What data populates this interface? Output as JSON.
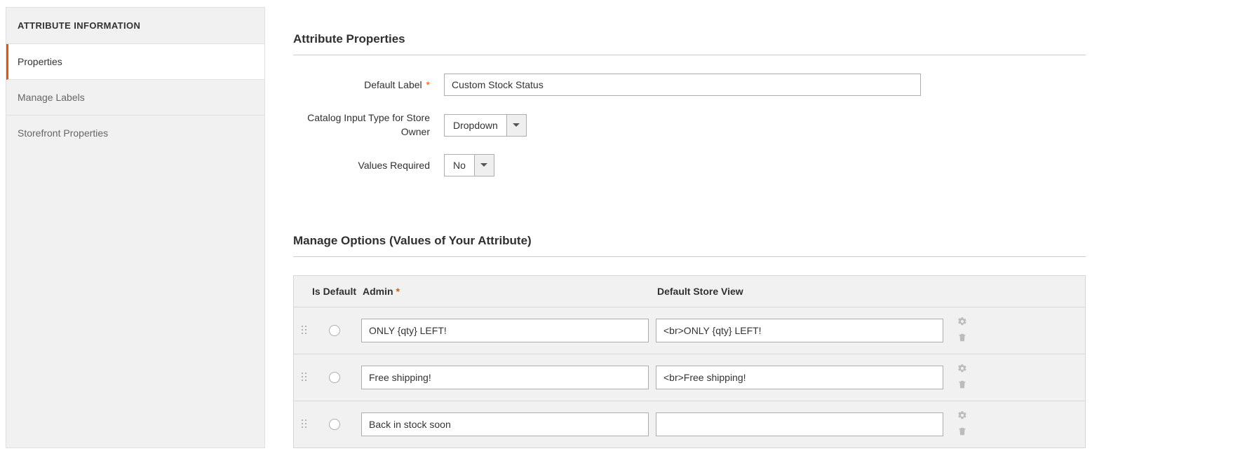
{
  "sidebar": {
    "header": "ATTRIBUTE INFORMATION",
    "items": [
      {
        "label": "Properties",
        "active": true
      },
      {
        "label": "Manage Labels",
        "active": false
      },
      {
        "label": "Storefront Properties",
        "active": false
      }
    ]
  },
  "attribute_properties": {
    "title": "Attribute Properties",
    "default_label_label": "Default Label",
    "default_label_value": "Custom Stock Status",
    "catalog_input_type_label": "Catalog Input Type for Store Owner",
    "catalog_input_type_value": "Dropdown",
    "values_required_label": "Values Required",
    "values_required_value": "No"
  },
  "manage_options": {
    "title": "Manage Options (Values of Your Attribute)",
    "columns": {
      "is_default": "Is Default",
      "admin": "Admin",
      "default_store_view": "Default Store View"
    },
    "rows": [
      {
        "admin": "ONLY {qty} LEFT!",
        "default_store_view": "<br>ONLY {qty} LEFT!"
      },
      {
        "admin": "Free shipping!",
        "default_store_view": "<br>Free shipping!"
      },
      {
        "admin": "Back in stock soon",
        "default_store_view": ""
      }
    ]
  }
}
